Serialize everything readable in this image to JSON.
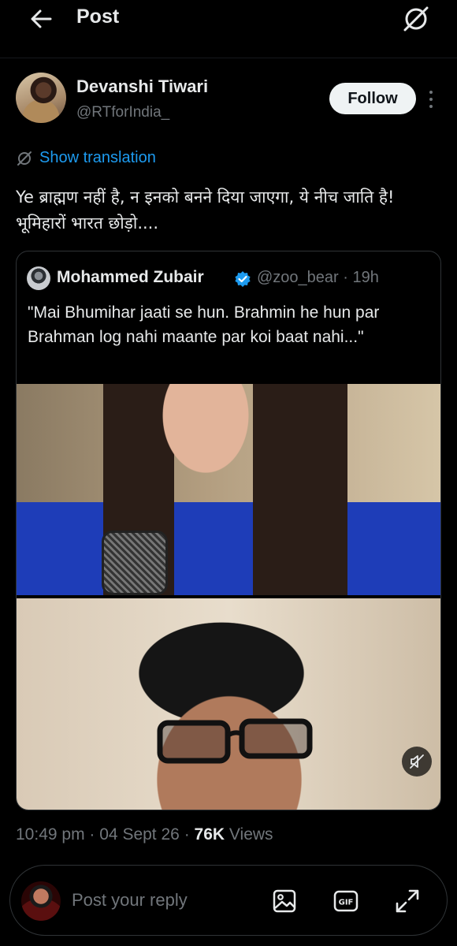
{
  "header": {
    "title": "Post"
  },
  "author": {
    "name": "Devanshi Tiwari",
    "handle": "@RTforIndia_",
    "follow_label": "Follow"
  },
  "translation": {
    "label": "Show translation"
  },
  "post": {
    "text": "Ye ब्राह्मण नहीं है, न इनको बनने दिया जाएगा, ये नीच जाति है! भूमिहारों भारत छोड़ो...."
  },
  "quote": {
    "name": "Mohammed Zubair",
    "handle": "@zoo_bear",
    "separator": "·",
    "age": "19h",
    "text": "\"Mai Bhumihar jaati se hun. Brahmin he hun par Brahman log nahi maante par koi baat nahi...\""
  },
  "meta": {
    "time": "10:49 pm",
    "date": "04 Sept 26",
    "views_count": "76K",
    "views_label": "Views",
    "dot": "·"
  },
  "reply": {
    "placeholder": "Post your reply"
  },
  "colors": {
    "accent": "#1d9bf0",
    "muted": "#71767b",
    "text": "#e7e9ea",
    "background": "#000000"
  },
  "icons": [
    "back-arrow-icon",
    "grok-icon",
    "more-icon",
    "translate-icon",
    "verified-badge-icon",
    "mute-icon",
    "image-icon",
    "gif-icon",
    "expand-icon"
  ]
}
